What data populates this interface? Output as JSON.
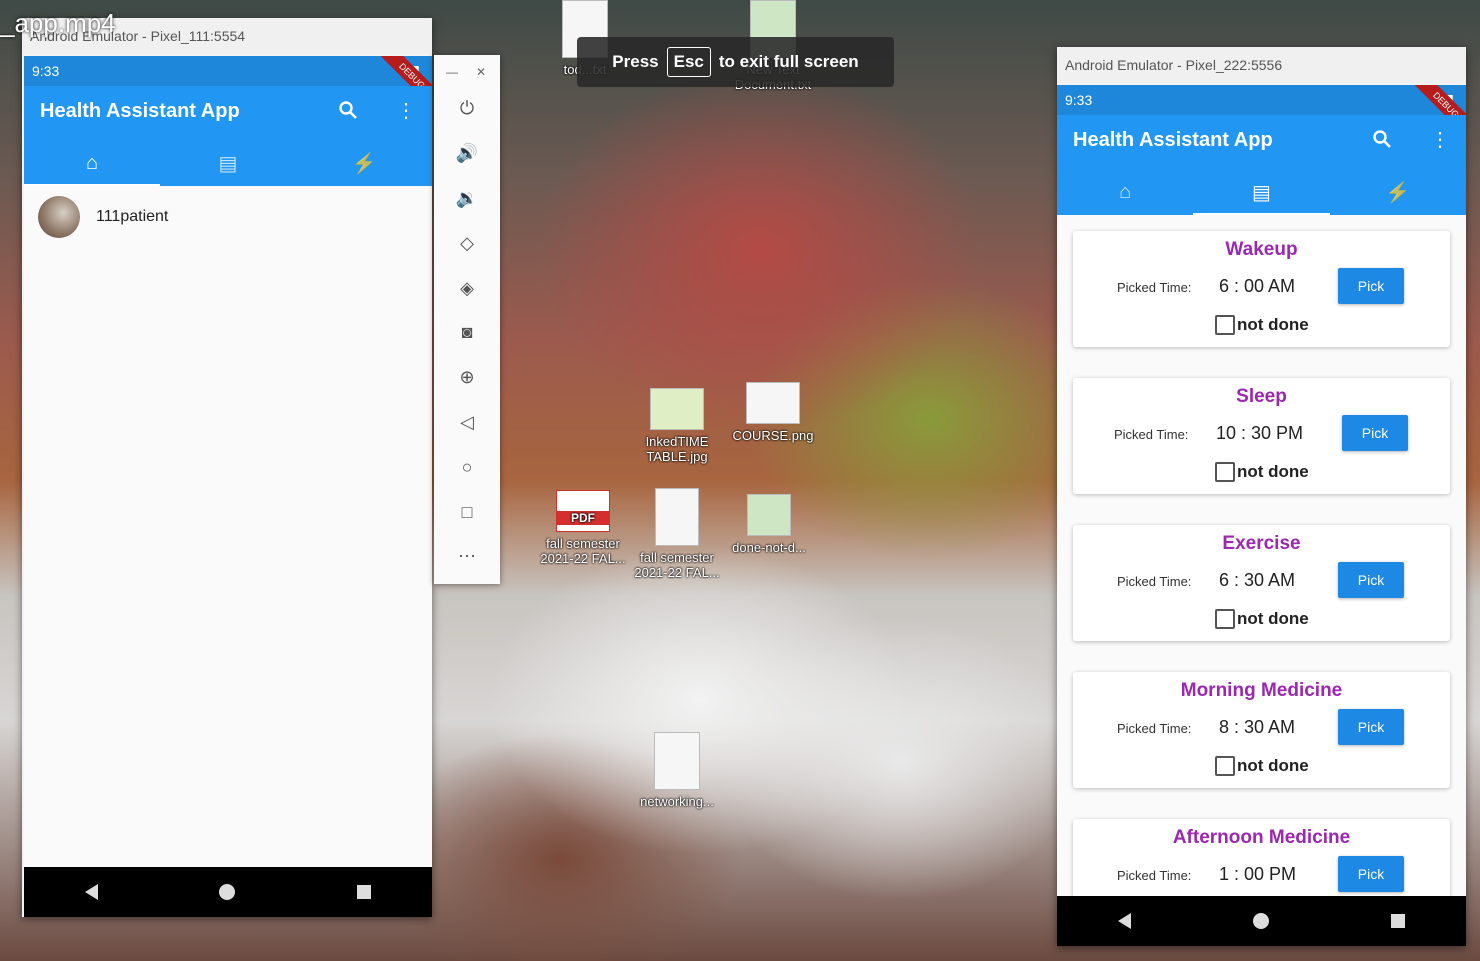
{
  "video_label": "_app.mp4",
  "fullscreen_notice": {
    "before": "Press",
    "key": "Esc",
    "after": "to exit full screen"
  },
  "desktop_icons": [
    {
      "label": "tod...txt"
    },
    {
      "label": "New Text Document.txt"
    },
    {
      "label": "InkedTIME TABLE.jpg"
    },
    {
      "label": "COURSE.png"
    },
    {
      "label": "fall semester 2021-22 FAL..."
    },
    {
      "label": "fall semester 2021-22 FAL..."
    },
    {
      "label": "done-not-d..."
    },
    {
      "label": "networking..."
    }
  ],
  "left_emulator": {
    "title": "Android Emulator - Pixel_111:5554",
    "status_time": "9:33",
    "app_title": "Health Assistant App",
    "patients": [
      {
        "name": "111patient"
      }
    ]
  },
  "right_emulator": {
    "title": "Android Emulator - Pixel_222:5556",
    "status_time": "9:33",
    "app_title": "Health Assistant App",
    "tasks": [
      {
        "name": "Wakeup",
        "picked_label": "Picked Time:",
        "time": "6 : 00 AM",
        "button": "Pick",
        "status": "not done"
      },
      {
        "name": "Sleep",
        "picked_label": "Picked Time:",
        "time": "10 : 30 PM",
        "button": "Pick",
        "status": "not done"
      },
      {
        "name": "Exercise",
        "picked_label": "Picked Time:",
        "time": "6 : 30 AM",
        "button": "Pick",
        "status": "not done"
      },
      {
        "name": "Morning Medicine",
        "picked_label": "Picked Time:",
        "time": "8 : 30 AM",
        "button": "Pick",
        "status": "not done"
      },
      {
        "name": "Afternoon Medicine",
        "picked_label": "Picked Time:",
        "time": "1 : 00 PM",
        "button": "Pick",
        "status": ""
      }
    ]
  },
  "icons": {
    "search": "search-icon",
    "menu": "more-vert-icon",
    "home": "home-icon",
    "list": "list-icon",
    "stats": "insights-icon"
  },
  "colors": {
    "app_bar": "#2196f3",
    "status_bar": "#1e87d9",
    "task_title": "#9c27b0",
    "pick_button": "#1e88e5"
  }
}
